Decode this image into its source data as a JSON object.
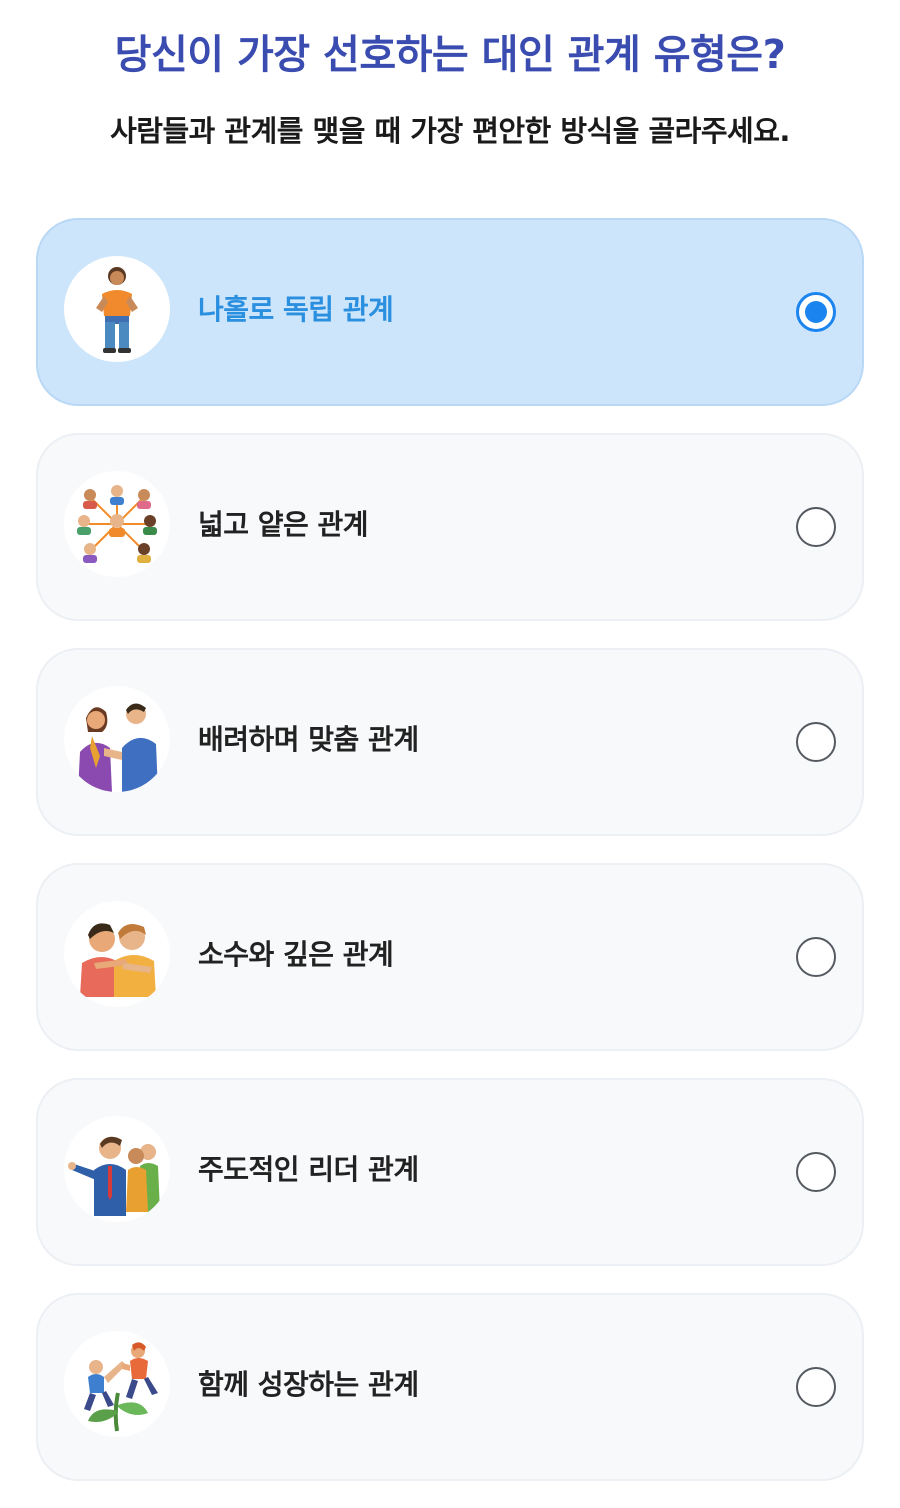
{
  "question": {
    "title": "당신이 가장 선호하는 대인 관계 유형은?",
    "subtitle": "사람들과 관계를 맺을 때 가장 편안한 방식을 골라주세요."
  },
  "colors": {
    "title": "#3a4cb0",
    "selected_bg": "#cde5fb",
    "selected_label": "#2b8fe0",
    "radio_accent": "#1b84ee",
    "card_bg": "#f7f9fb"
  },
  "options": [
    {
      "label": "나홀로 독립 관계",
      "icon": "standing-person-icon",
      "selected": true
    },
    {
      "label": "넓고 얕은 관계",
      "icon": "network-people-icon",
      "selected": false
    },
    {
      "label": "배려하며 맞춤 관계",
      "icon": "caring-couple-icon",
      "selected": false
    },
    {
      "label": "소수와 깊은 관계",
      "icon": "close-friends-icon",
      "selected": false
    },
    {
      "label": "주도적인 리더 관계",
      "icon": "leader-pointing-icon",
      "selected": false
    },
    {
      "label": "함께 성장하는 관계",
      "icon": "climbing-together-icon",
      "selected": false
    }
  ]
}
